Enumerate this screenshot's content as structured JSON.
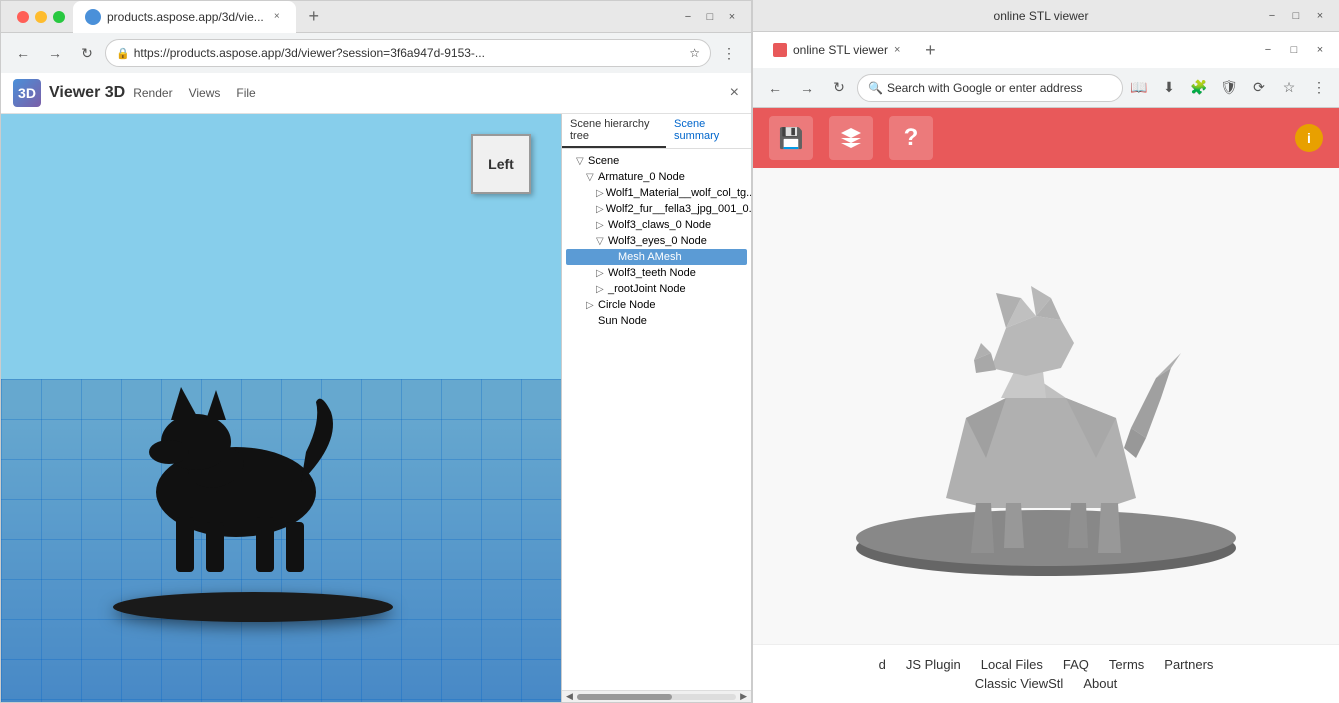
{
  "left_window": {
    "tab_title": "products.aspose.app/3d/vie...",
    "tab_favicon": "3d",
    "address": "https://products.aspose.app/3d/viewer?session=3f6a947d-9153-...",
    "app_title": "Viewer 3D",
    "app_menu": [
      "Render",
      "Views",
      "File"
    ],
    "close_btn": "×",
    "viewport_label": "Left",
    "scene_tabs": [
      "Scene hierarchy tree",
      "Scene summary"
    ],
    "scene_items": [
      {
        "label": "Scene",
        "level": 0,
        "expanded": true,
        "arrow": "▽"
      },
      {
        "label": "Armature_0 Node",
        "level": 1,
        "expanded": true,
        "arrow": "▽"
      },
      {
        "label": "Wolf1_Material__wolf_col_tg...",
        "level": 2,
        "expanded": false,
        "arrow": "▷"
      },
      {
        "label": "Wolf2_fur__fella3_jpg_001_0...",
        "level": 2,
        "expanded": false,
        "arrow": "▷"
      },
      {
        "label": "Wolf3_claws_0 Node",
        "level": 2,
        "expanded": false,
        "arrow": "▷"
      },
      {
        "label": "Wolf3_eyes_0 Node",
        "level": 2,
        "expanded": true,
        "arrow": "▽"
      },
      {
        "label": "Mesh AMesh",
        "level": 3,
        "selected": true
      },
      {
        "label": "Wolf3_teeth Node",
        "level": 2,
        "expanded": false,
        "arrow": "▷"
      },
      {
        "label": "_rootJoint Node",
        "level": 2,
        "expanded": false,
        "arrow": "▷"
      },
      {
        "label": "Circle Node",
        "level": 1,
        "expanded": false,
        "arrow": "▷"
      },
      {
        "label": "Sun Node",
        "level": 1,
        "expanded": false,
        "arrow": ""
      }
    ]
  },
  "right_window": {
    "tab_title": "online STL viewer",
    "os_title": "online STL viewer",
    "address": "Search with Google or enter address",
    "toolbar_buttons": [
      "save",
      "box",
      "help"
    ],
    "info_label": "i",
    "footer_links_row1": [
      "JS Plugin",
      "Local Files",
      "FAQ",
      "Terms",
      "Partners"
    ],
    "footer_links_row2": [
      "Classic ViewStl",
      "About"
    ],
    "footer_partial": "d"
  },
  "icons": {
    "back": "←",
    "forward": "→",
    "refresh": "↻",
    "lock": "🔒",
    "star": "☆",
    "menu": "⋮",
    "close": "×",
    "minimize": "−",
    "maximize": "□",
    "save": "💾",
    "box": "📦",
    "help": "?",
    "left_arrow": "◀",
    "right_arrow": "▶"
  }
}
